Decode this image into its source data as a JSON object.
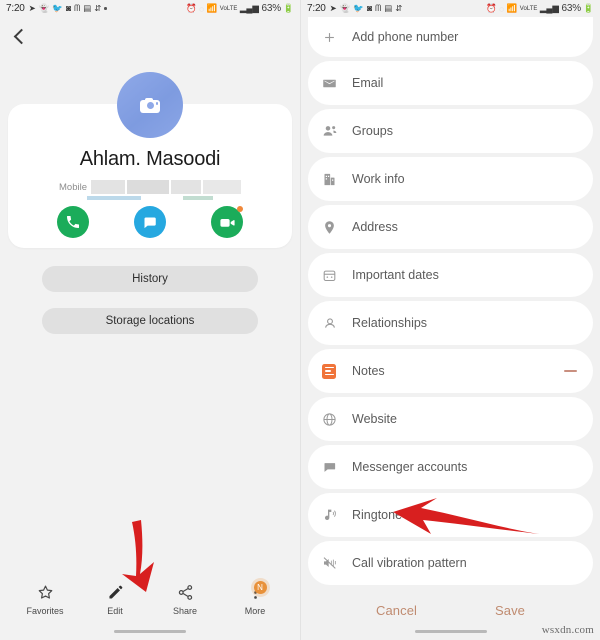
{
  "status_bar": {
    "time": "7:20",
    "left_icons": [
      "telegram-icon",
      "snapchat-icon",
      "twitter-icon",
      "instagram-icon",
      "messenger-icon",
      "news-icon",
      "data-saver-icon",
      "dot-icon"
    ],
    "right_icons": [
      "alarm-icon",
      "mute-icon",
      "wifi-calling-icon",
      "volte-icon",
      "signal-icon"
    ],
    "battery_percent": "63%"
  },
  "left_screen": {
    "back_button": "back-arrow",
    "avatar_icon": "camera-icon",
    "contact_name": "Ahlam. Masoodi",
    "phone_label": "Mobile",
    "phone_number_redacted": "",
    "actions": [
      {
        "name": "call",
        "icon": "phone-icon",
        "color": "#1bac5a"
      },
      {
        "name": "message",
        "icon": "message-icon",
        "color": "#26a8e0"
      },
      {
        "name": "video-call",
        "icon": "video-camera-icon",
        "color": "#1bac5a"
      }
    ],
    "buttons": [
      {
        "label": "History"
      },
      {
        "label": "Storage locations"
      }
    ],
    "bottom_nav": [
      {
        "label": "Favorites",
        "icon": "star-icon",
        "badge": ""
      },
      {
        "label": "Edit",
        "icon": "pencil-icon",
        "badge": ""
      },
      {
        "label": "Share",
        "icon": "share-icon",
        "badge": ""
      },
      {
        "label": "More",
        "icon": "more-icon",
        "badge": "N"
      }
    ],
    "annotation": {
      "type": "red-arrow",
      "points_to": "Edit"
    }
  },
  "right_screen": {
    "fields": [
      {
        "label": "Add phone number",
        "icon": "plus-icon",
        "accent": false,
        "has_minus": false
      },
      {
        "label": "Email",
        "icon": "envelope-icon",
        "accent": false,
        "has_minus": false
      },
      {
        "label": "Groups",
        "icon": "people-icon",
        "accent": false,
        "has_minus": false
      },
      {
        "label": "Work info",
        "icon": "building-icon",
        "accent": false,
        "has_minus": false
      },
      {
        "label": "Address",
        "icon": "location-pin-icon",
        "accent": false,
        "has_minus": false
      },
      {
        "label": "Important dates",
        "icon": "calendar-icon",
        "accent": false,
        "has_minus": false
      },
      {
        "label": "Relationships",
        "icon": "relationship-icon",
        "accent": false,
        "has_minus": false
      },
      {
        "label": "Notes",
        "icon": "notes-icon",
        "accent": true,
        "has_minus": true
      },
      {
        "label": "Website",
        "icon": "globe-icon",
        "accent": false,
        "has_minus": false
      },
      {
        "label": "Messenger accounts",
        "icon": "chat-bubble-icon",
        "accent": false,
        "has_minus": false
      },
      {
        "label": "Ringtone",
        "icon": "ringtone-icon",
        "accent": false,
        "has_minus": false
      },
      {
        "label": "Call vibration pattern",
        "icon": "vibration-mute-icon",
        "accent": false,
        "has_minus": false
      }
    ],
    "footer": {
      "cancel_label": "Cancel",
      "save_label": "Save"
    },
    "annotation": {
      "type": "red-arrow",
      "points_to": "Ringtone"
    }
  },
  "watermark": "wsxdn.com",
  "colors": {
    "accent_orange": "#f0743a",
    "footer_text": "#c08b70",
    "call_green": "#1bac5a",
    "message_blue": "#26a8e0",
    "annotation_red": "#d81f1f",
    "avatar_blue": "#8fa9e8"
  }
}
